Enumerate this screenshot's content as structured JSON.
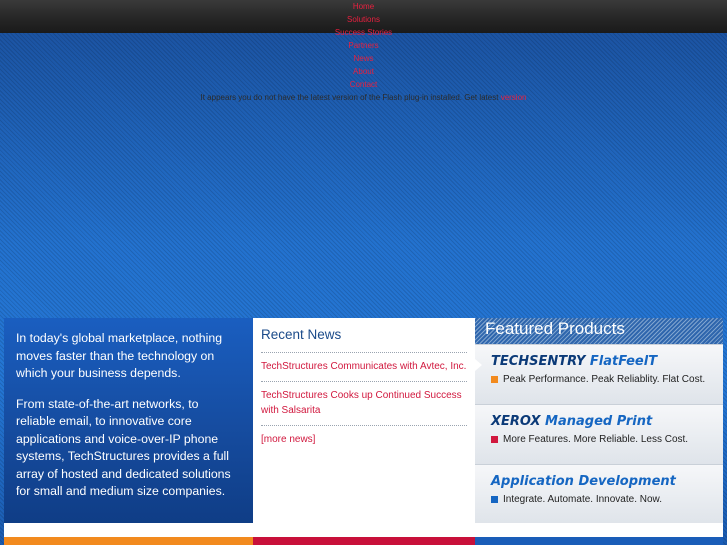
{
  "nav": {
    "items": [
      "Home",
      "Solutions",
      "Success Stories",
      "Partners",
      "News",
      "About",
      "Contact"
    ],
    "flash_message": "It appears you do not have the latest version of the Flash plug-in installed. Get latest",
    "flash_link": "version"
  },
  "intro": {
    "paragraph1": "In today's global marketplace, nothing moves faster than the technology on which your business depends.",
    "paragraph2": "From state-of-the-art networks, to reliable email, to innovative core applications and voice-over-IP phone systems, TechStructures provides a full array of hosted and dedicated solutions for small and medium size companies."
  },
  "news": {
    "title": "Recent News",
    "items": [
      "TechStructures Communicates with Avtec, Inc.",
      "TechStructures Cooks up Continued Success with Salsarita"
    ],
    "more": "[more news]"
  },
  "featured": {
    "title": "Featured Products",
    "products": [
      {
        "name_a": "TECHSENTRY",
        "name_b": " FlatFeelT",
        "tagline": "Peak Performance. Peak Reliablity. Flat Cost.",
        "color": "#f28a1e"
      },
      {
        "name_a": "XEROX",
        "name_b": " Managed Print",
        "tagline": "More Features. More Reliable. Less Cost.",
        "color": "#d1183e"
      },
      {
        "name_a": "Application Development",
        "name_b": "",
        "tagline": "Integrate. Automate. Innovate. Now.",
        "color": "#1566c2"
      }
    ]
  },
  "colors": {
    "stripe_orange": "#f28a1e",
    "stripe_red": "#c8103a",
    "stripe_blue": "#1a5db8"
  }
}
